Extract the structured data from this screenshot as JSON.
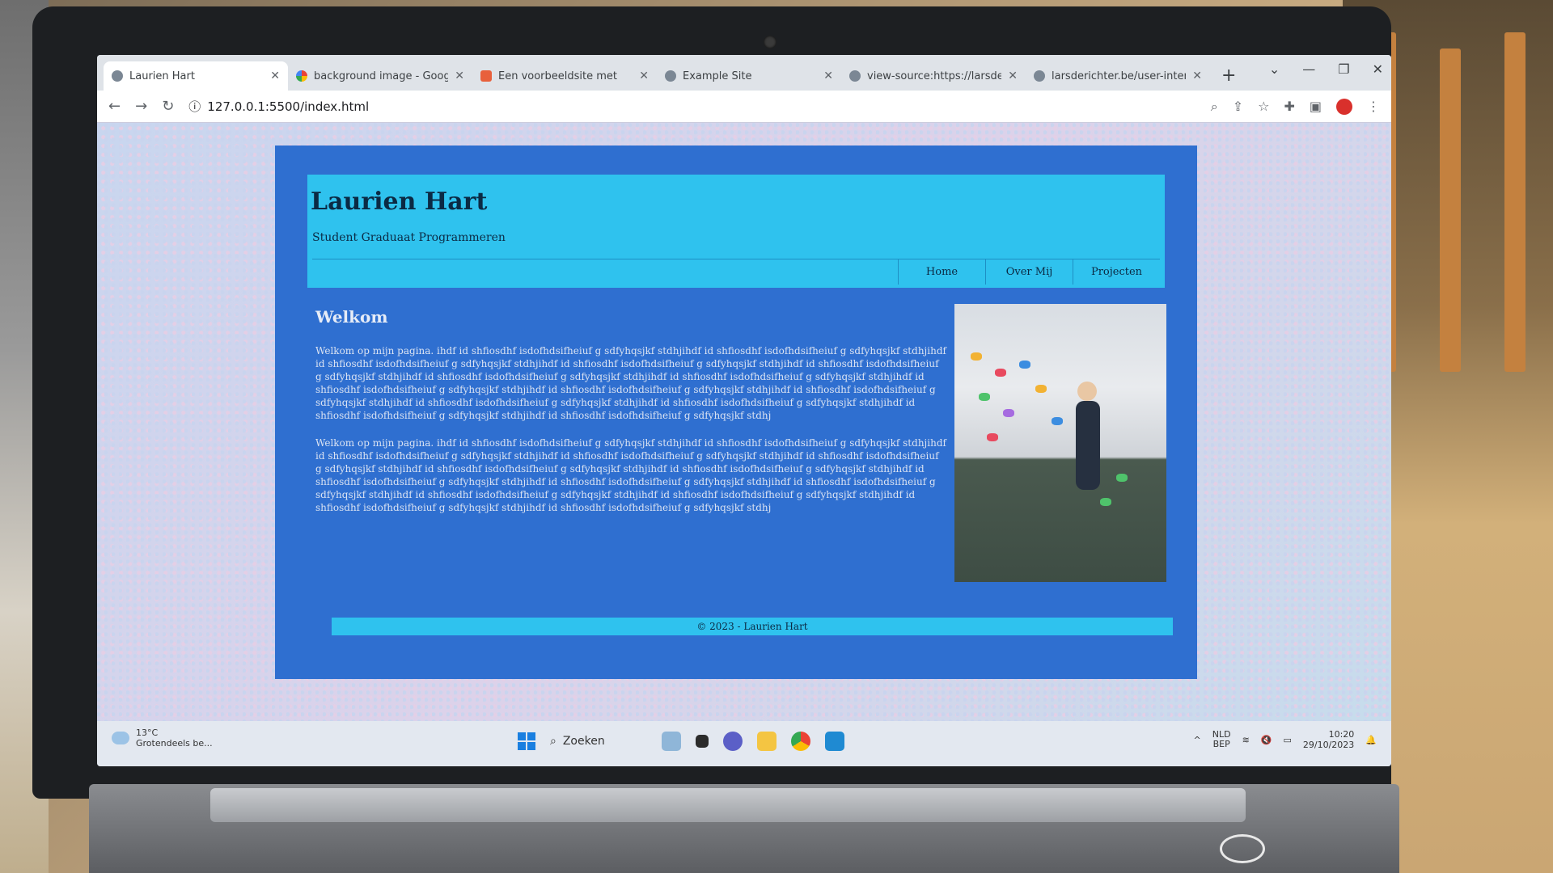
{
  "browser": {
    "tabs": [
      {
        "title": "Laurien Hart",
        "favicon": "globe-icon",
        "active": true
      },
      {
        "title": "background image - Goog",
        "favicon": "google-icon",
        "active": false
      },
      {
        "title": "Een voorbeeldsite met",
        "favicon": "app-icon",
        "active": false
      },
      {
        "title": "Example Site",
        "favicon": "globe-icon",
        "active": false
      },
      {
        "title": "view-source:https://larsde",
        "favicon": "globe-icon",
        "active": false
      },
      {
        "title": "larsderichter.be/user-inter",
        "favicon": "globe-icon",
        "active": false
      }
    ],
    "new_tab": "+",
    "url": "127.0.0.1:5500/index.html"
  },
  "page": {
    "title": "Laurien Hart",
    "subtitle": "Student Graduaat Programmeren",
    "nav": [
      "Home",
      "Over Mij",
      "Projecten"
    ],
    "heading": "Welkom",
    "paragraphs": [
      "Welkom op mijn pagina. ihdf id shfiosdhf isdofhdsifheiuf g sdfyhqsjkf stdhjihdf id shfiosdhf isdofhdsifheiuf g sdfyhqsjkf stdhjihdf id shfiosdhf isdofhdsifheiuf g sdfyhqsjkf stdhjihdf id shfiosdhf isdofhdsifheiuf g sdfyhqsjkf stdhjihdf id shfiosdhf isdofhdsifheiuf g sdfyhqsjkf stdhjihdf id shfiosdhf isdofhdsifheiuf g sdfyhqsjkf stdhjihdf id shfiosdhf isdofhdsifheiuf g sdfyhqsjkf stdhjihdf id shfiosdhf isdofhdsifheiuf g sdfyhqsjkf stdhjihdf id shfiosdhf isdofhdsifheiuf g sdfyhqsjkf stdhjihdf id shfiosdhf isdofhdsifheiuf g sdfyhqsjkf stdhjihdf id shfiosdhf isdofhdsifheiuf g sdfyhqsjkf stdhjihdf id shfiosdhf isdofhdsifheiuf g sdfyhqsjkf stdhjihdf id shfiosdhf isdofhdsifheiuf g sdfyhqsjkf stdhjihdf id shfiosdhf isdofhdsifheiuf g sdfyhqsjkf stdhj",
      "Welkom op mijn pagina. ihdf id shfiosdhf isdofhdsifheiuf g sdfyhqsjkf stdhjihdf id shfiosdhf isdofhdsifheiuf g sdfyhqsjkf stdhjihdf id shfiosdhf isdofhdsifheiuf g sdfyhqsjkf stdhjihdf id shfiosdhf isdofhdsifheiuf g sdfyhqsjkf stdhjihdf id shfiosdhf isdofhdsifheiuf g sdfyhqsjkf stdhjihdf id shfiosdhf isdofhdsifheiuf g sdfyhqsjkf stdhjihdf id shfiosdhf isdofhdsifheiuf g sdfyhqsjkf stdhjihdf id shfiosdhf isdofhdsifheiuf g sdfyhqsjkf stdhjihdf id shfiosdhf isdofhdsifheiuf g sdfyhqsjkf stdhjihdf id shfiosdhf isdofhdsifheiuf g sdfyhqsjkf stdhjihdf id shfiosdhf isdofhdsifheiuf g sdfyhqsjkf stdhjihdf id shfiosdhf isdofhdsifheiuf g sdfyhqsjkf stdhjihdf id shfiosdhf isdofhdsifheiuf g sdfyhqsjkf stdhjihdf id shfiosdhf isdofhdsifheiuf g sdfyhqsjkf stdhj"
    ],
    "footer": "© 2023 - Laurien Hart",
    "colors": {
      "outer": "#2f6fd0",
      "band": "#2fc2ee"
    }
  },
  "taskbar": {
    "weather_temp": "13°C",
    "weather_desc": "Grotendeels be...",
    "search": "Zoeken",
    "lang": "NLD",
    "lang2": "BEP",
    "time": "10:20",
    "date": "29/10/2023"
  }
}
